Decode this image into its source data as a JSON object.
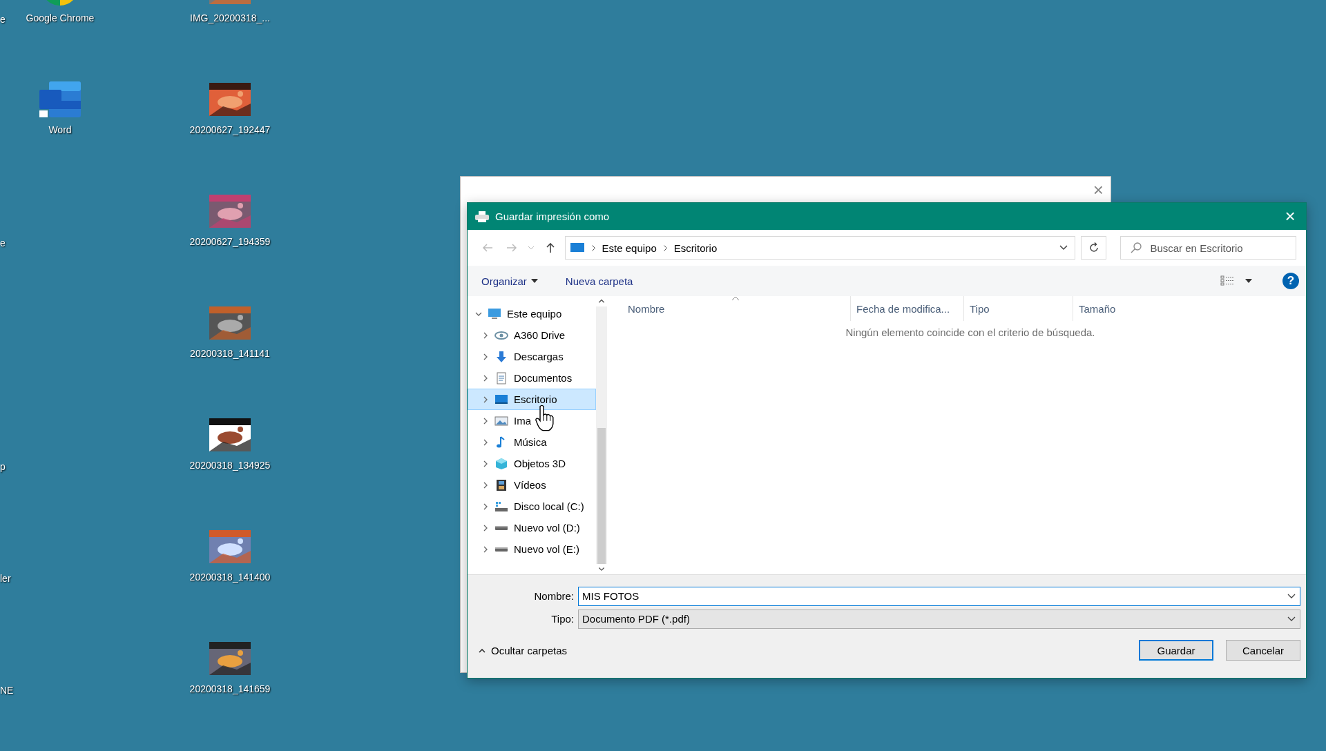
{
  "desktop": {
    "edge_labels": [
      "e",
      "e",
      "p",
      "ler",
      "NE"
    ],
    "column_1": [
      {
        "label": "Google Chrome",
        "kind": "chrome"
      },
      {
        "label": "Word",
        "kind": "word"
      }
    ],
    "column_2": [
      {
        "label": "IMG_20200318_..."
      },
      {
        "label": "20200627_192447"
      },
      {
        "label": "20200627_194359"
      },
      {
        "label": "20200318_141141"
      },
      {
        "label": "20200318_134925"
      },
      {
        "label": "20200318_141400"
      },
      {
        "label": "20200318_141659"
      }
    ]
  },
  "back_window": {
    "close": "×"
  },
  "dialog": {
    "title": "Guardar impresión como",
    "close": "×",
    "breadcrumb": [
      "Este equipo",
      "Escritorio"
    ],
    "search": {
      "placeholder": "Buscar en Escritorio"
    },
    "toolbar": {
      "organize": "Organizar",
      "new_folder": "Nueva carpeta",
      "help": "?"
    },
    "tree": [
      {
        "label": "Este equipo",
        "kind": "computer",
        "expanded": true,
        "selected": false,
        "children": [
          {
            "label": "A360 Drive",
            "kind": "cloud",
            "expanded": false,
            "selected": false
          },
          {
            "label": "Descargas",
            "kind": "download",
            "expanded": false,
            "selected": false
          },
          {
            "label": "Documentos",
            "kind": "document",
            "expanded": false,
            "selected": false
          },
          {
            "label": "Escritorio",
            "kind": "desktop",
            "expanded": false,
            "selected": true
          },
          {
            "label": "Ima",
            "kind": "images",
            "expanded": false,
            "selected": false
          },
          {
            "label": "Música",
            "kind": "music",
            "expanded": false,
            "selected": false
          },
          {
            "label": "Objetos 3D",
            "kind": "objects",
            "expanded": false,
            "selected": false
          },
          {
            "label": "Vídeos",
            "kind": "videos",
            "expanded": false,
            "selected": false
          },
          {
            "label": "Disco local (C:)",
            "kind": "system_drive",
            "expanded": false,
            "selected": false
          },
          {
            "label": "Nuevo vol (D:)",
            "kind": "drive",
            "expanded": false,
            "selected": false
          },
          {
            "label": "Nuevo vol (E:)",
            "kind": "drive",
            "expanded": false,
            "selected": false
          }
        ]
      }
    ],
    "columns": [
      "Nombre",
      "Fecha de modifica...",
      "Tipo",
      "Tamaño"
    ],
    "empty_message": "Ningún elemento coincide con el criterio de búsqueda.",
    "filename": {
      "label": "Nombre:",
      "value": "MIS FOTOS"
    },
    "filetype": {
      "label": "Tipo:",
      "value": "Documento PDF (*.pdf)"
    },
    "hide_folders": "Ocultar carpetas",
    "buttons": [
      {
        "label": "Guardar",
        "kind": "default"
      },
      {
        "label": "Cancelar",
        "kind": "normal"
      }
    ]
  }
}
